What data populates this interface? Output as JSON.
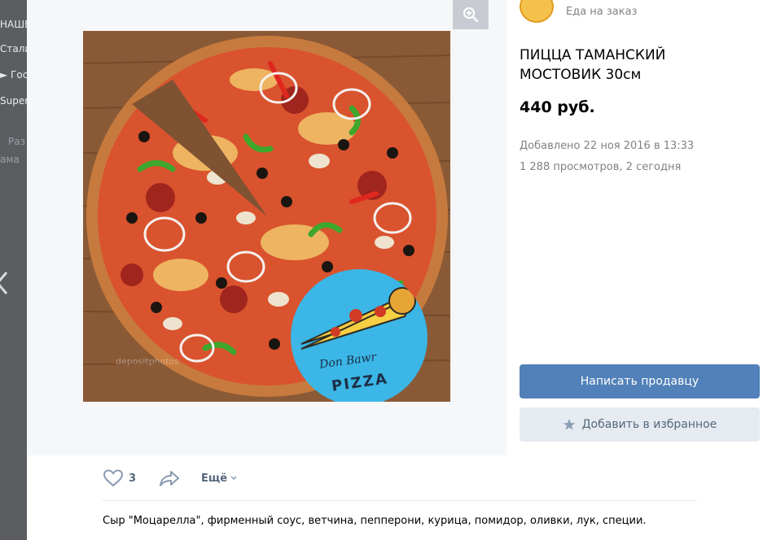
{
  "backdrop": {
    "items": [
      "НАШЕ",
      "Стали",
      "► Гос",
      "Super",
      "Раз",
      "ама"
    ]
  },
  "product": {
    "shop_name": "Еда на заказ",
    "title": "ПИЦЦА ТАМАНСКИЙ МОСТОВИК 30см",
    "price": "440 руб.",
    "added": "Добавлено 22 ноя 2016 в 13:33",
    "views": "1 288 просмотров, 2 сегодня",
    "description": "Сыр \"Моцарелла\", фирменный соус, ветчина, пепперони, курица, помидор, оливки, лук, специи."
  },
  "buttons": {
    "contact_seller": "Написать продавцу",
    "add_favorite": "Добавить в избранное"
  },
  "actions": {
    "like_count": "3",
    "more_label": "Ещё"
  },
  "logo": {
    "text_top": "Don Bawr",
    "text_bottom": "PIZZA"
  },
  "watermark": "depositphotos",
  "colors": {
    "primary_button": "#5181b8",
    "secondary_button": "#e5ebf1",
    "action_text": "#55677d",
    "logo_circle": "#3bb6e6"
  },
  "icons": [
    "arrow-left-icon",
    "zoom-in-icon",
    "heart-icon",
    "share-icon",
    "chevron-down-icon",
    "star-icon"
  ]
}
